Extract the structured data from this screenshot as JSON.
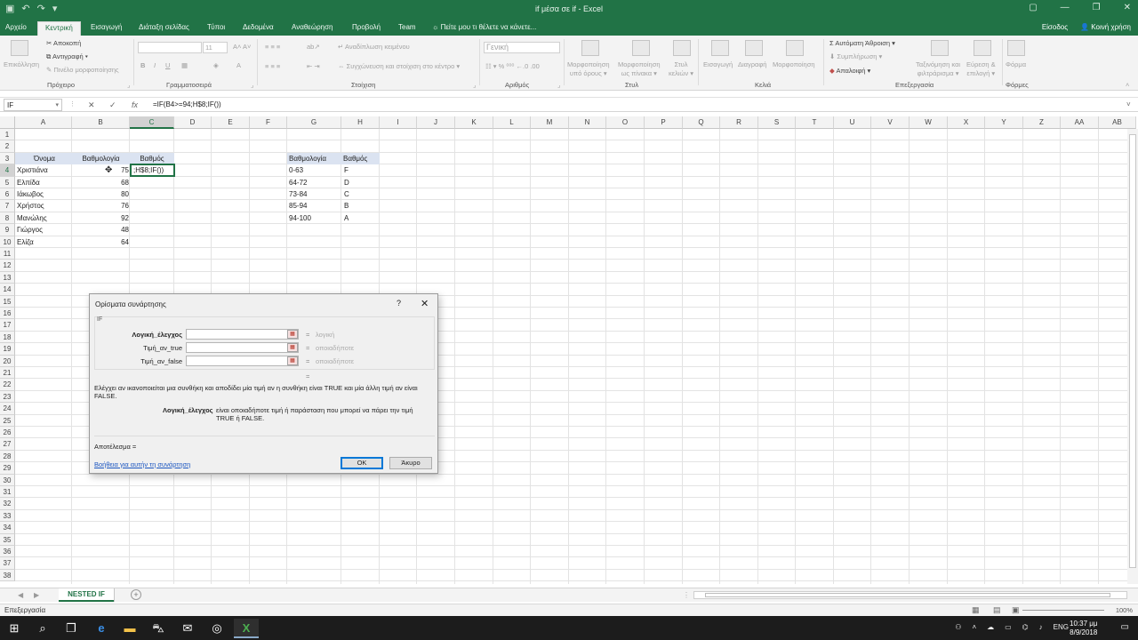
{
  "title_bar": {
    "title": "if μέσα σε if - Excel"
  },
  "tabs": {
    "items": [
      "Αρχείο",
      "Κεντρική",
      "Εισαγωγή",
      "Διάταξη σελίδας",
      "Τύποι",
      "Δεδομένα",
      "Αναθεώρηση",
      "Προβολή",
      "Team"
    ],
    "tell_me": "Πείτε μου τι θέλετε να κάνετε...",
    "sign_in": "Είσοδος",
    "share": "Κοινή χρήση"
  },
  "ribbon": {
    "paste": "Επικόλληση",
    "cut": "Αποκοπή",
    "copy": "Αντιγραφή",
    "format_painter": "Πινέλο μορφοποίησης",
    "clipboard": "Πρόχειρο",
    "font_size": "11",
    "font_group": "Γραμματοσειρά",
    "wrap_text": "Αναδίπλωση κειμένου",
    "merge_center": "Συγχώνευση και στοίχιση στο κέντρο",
    "alignment": "Στοίχιση",
    "number_format": "Γενική",
    "number": "Αριθμός",
    "cond_format_1": "Μορφοποίηση",
    "cond_format_2": "υπό όρους",
    "format_table_1": "Μορφοποίηση",
    "format_table_2": "ως πίνακα",
    "cell_styles_1": "Στυλ",
    "cell_styles_2": "κελιών",
    "styles": "Στυλ",
    "insert": "Εισαγωγή",
    "delete": "Διαγραφή",
    "format": "Μορφοποίηση",
    "cells": "Κελιά",
    "autosum": "Αυτόματη Άθροιση",
    "fill": "Συμπλήρωση",
    "clear": "Απαλοιφή",
    "sort_1": "Ταξινόμηση και",
    "sort_2": "φιλτράρισμα",
    "find_1": "Εύρεση &",
    "find_2": "επιλογή",
    "editing": "Επεξεργασία",
    "forms_btn": "Φόρμα",
    "forms": "Φόρμες"
  },
  "formula_bar": {
    "name_box": "IF",
    "formula": "=IF(B4>=94;H$8;IF())"
  },
  "columns": [
    "A",
    "B",
    "C",
    "D",
    "E",
    "F",
    "G",
    "H",
    "I",
    "J",
    "K",
    "L",
    "M",
    "N",
    "O",
    "P",
    "Q",
    "R",
    "S",
    "T",
    "U",
    "V",
    "W",
    "X",
    "Y",
    "Z",
    "AA",
    "AB"
  ],
  "rows": [
    "1",
    "2",
    "3",
    "4",
    "5",
    "6",
    "7",
    "8",
    "9",
    "10",
    "11",
    "12",
    "13",
    "14",
    "15",
    "16",
    "17",
    "18",
    "19",
    "20",
    "21",
    "22",
    "23",
    "24",
    "25",
    "26",
    "27",
    "28",
    "29",
    "30",
    "31",
    "32",
    "33",
    "34",
    "35",
    "36",
    "37",
    "38"
  ],
  "table1": {
    "headers": [
      "Όνομα",
      "Βαθμολογία",
      "Βαθμός"
    ],
    "names": [
      "Χριστιάνα",
      "Ελπίδα",
      "Ιάκωβος",
      "Χρήστος",
      "Μανώλης",
      "Γιώργος",
      "Ελίζα"
    ],
    "scores": [
      "75",
      "68",
      "80",
      "76",
      "92",
      "48",
      "64"
    ],
    "active_cell": ";H$8;IF())"
  },
  "table2": {
    "headers": [
      "Βαθμολογία",
      "Βαθμός"
    ],
    "ranges": [
      "0-63",
      "64-72",
      "73-84",
      "85-94",
      "94-100"
    ],
    "grades": [
      "F",
      "D",
      "C",
      "B",
      "A"
    ]
  },
  "dialog": {
    "title": "Ορίσματα συνάρτησης",
    "help_q": "?",
    "function": "IF",
    "args": [
      {
        "label": "Λογική_έλεγχος",
        "eq": "=",
        "value": "λογική"
      },
      {
        "label": "Τιμή_αν_true",
        "eq": "=",
        "value": "οποιαδήποτε"
      },
      {
        "label": "Τιμή_αν_false",
        "eq": "=",
        "value": "οποιαδήποτε"
      }
    ],
    "result_eq": "=",
    "description": "Ελέγχει αν ικανοποιείται μια συνθήκη και αποδίδει μία τιμή αν η συνθήκη είναι TRUE και μία άλλη τιμή αν είναι FALSE.",
    "arg_name": "Λογική_έλεγχος",
    "arg_desc": "είναι οποιαδήποτε τιμή ή παράσταση που μπορεί να πάρει την τιμή TRUE ή FALSE.",
    "result": "Αποτέλεσμα =",
    "help_link": "Βοήθεια για αυτήν τη συνάρτηση",
    "ok": "OK",
    "cancel": "Άκυρο"
  },
  "sheet": {
    "tab": "NESTED IF"
  },
  "status": {
    "mode": "Επεξεργασία",
    "zoom": "100%"
  },
  "taskbar": {
    "lang": "ENG",
    "time": "10:37 μμ",
    "date": "8/9/2018"
  }
}
